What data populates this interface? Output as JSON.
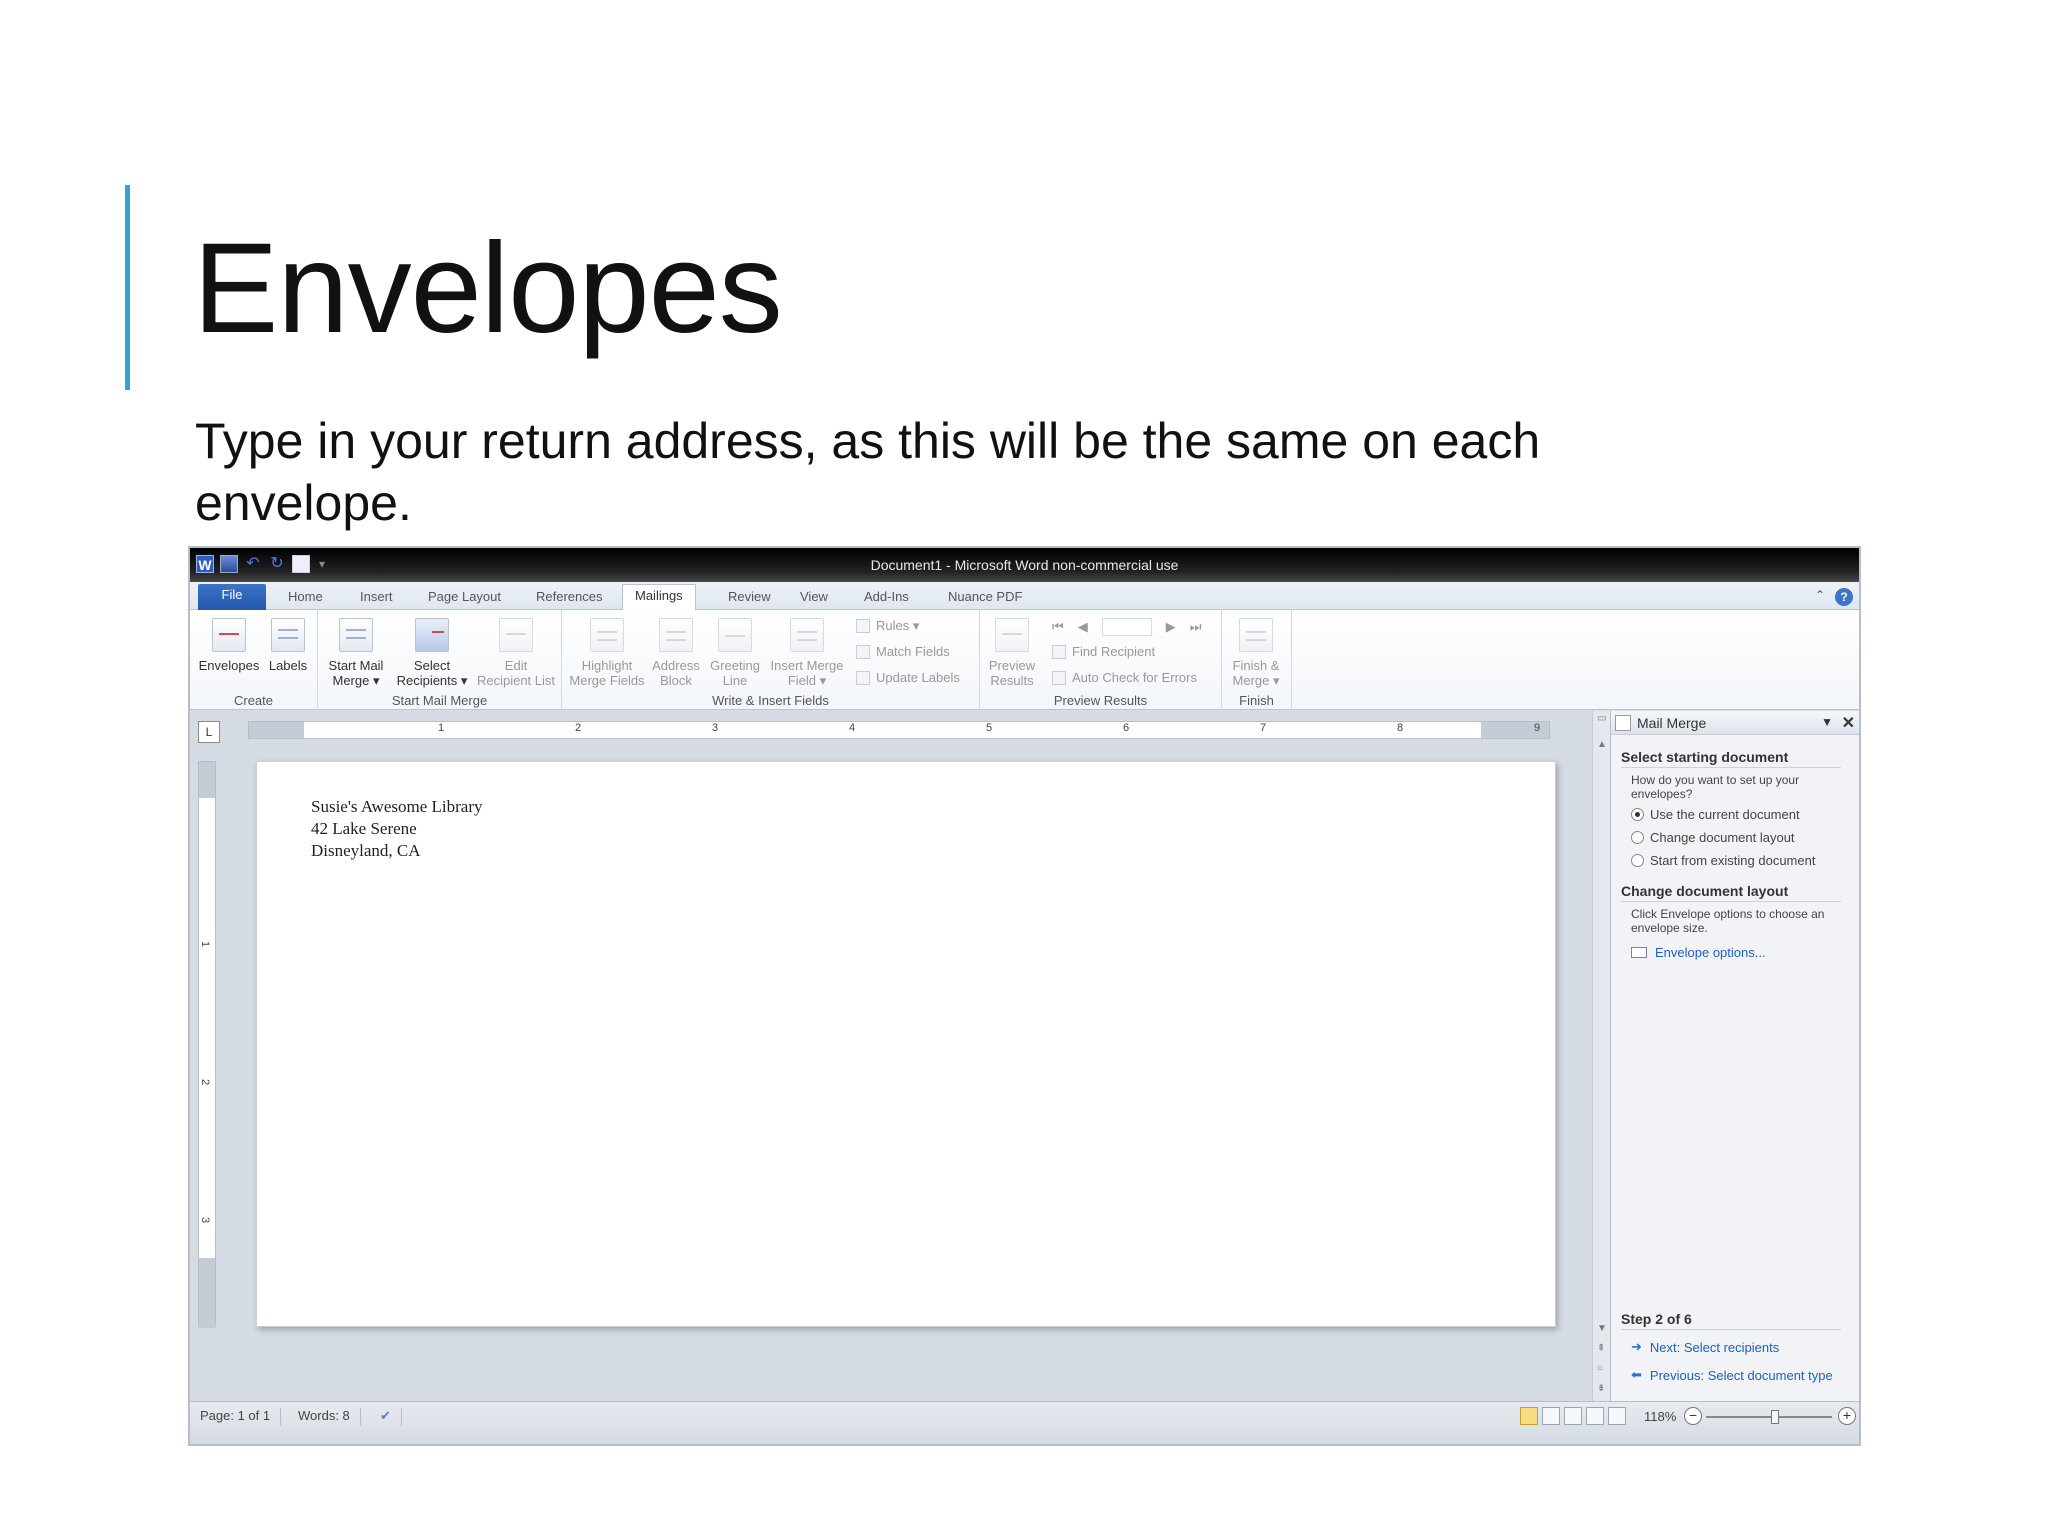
{
  "slide": {
    "title": "Envelopes",
    "body": "Type in your return address, as this will be the same on each envelope.",
    "accent_color": "#31a5d0"
  },
  "window": {
    "title": "Document1  -  Microsoft Word non-commercial use"
  },
  "tabs": [
    {
      "label": "File"
    },
    {
      "label": "Home"
    },
    {
      "label": "Insert"
    },
    {
      "label": "Page Layout"
    },
    {
      "label": "References"
    },
    {
      "label": "Mailings",
      "active": true
    },
    {
      "label": "Review"
    },
    {
      "label": "View"
    },
    {
      "label": "Add-Ins"
    },
    {
      "label": "Nuance PDF"
    }
  ],
  "ribbon": {
    "create": {
      "label": "Create",
      "envelopes": "Envelopes",
      "labels": "Labels"
    },
    "start_mail_merge": {
      "label": "Start Mail Merge",
      "start_mail_merge": [
        "Start Mail",
        "Merge ▾"
      ],
      "select_recipients": [
        "Select",
        "Recipients ▾"
      ],
      "edit_recipient_list": [
        "Edit",
        "Recipient List"
      ]
    },
    "write_insert": {
      "label": "Write & Insert Fields",
      "highlight": [
        "Highlight",
        "Merge Fields"
      ],
      "address_block": [
        "Address",
        "Block"
      ],
      "greeting_line": [
        "Greeting",
        "Line"
      ],
      "insert_merge_field": [
        "Insert Merge",
        "Field ▾"
      ],
      "rules": "Rules ▾",
      "match_fields": "Match Fields",
      "update_labels": "Update Labels"
    },
    "preview": {
      "label": "Preview Results",
      "preview_results": [
        "Preview",
        "Results"
      ],
      "find_recipient": "Find Recipient",
      "auto_check": "Auto Check for Errors"
    },
    "finish": {
      "label": "Finish",
      "finish_merge": [
        "Finish &",
        "Merge ▾"
      ]
    }
  },
  "ruler": {
    "corner": "L",
    "h_ticks": [
      "1",
      "2",
      "3",
      "4",
      "5",
      "6",
      "7",
      "8",
      "9"
    ],
    "v_ticks": [
      "1",
      "2",
      "3"
    ]
  },
  "document": {
    "return_address": [
      "Susie's Awesome Library",
      "42 Lake Serene",
      "Disneyland, CA"
    ]
  },
  "task_pane": {
    "title": "Mail Merge",
    "section1_title": "Select starting document",
    "section1_question": "How do you want to set up your envelopes?",
    "options": [
      {
        "label": "Use the current document",
        "selected": true
      },
      {
        "label": "Change document layout",
        "selected": false
      },
      {
        "label": "Start from existing document",
        "selected": false
      }
    ],
    "section2_title": "Change document layout",
    "section2_text": "Click Envelope options to choose an envelope size.",
    "envelope_options_link": "Envelope options...",
    "step": "Step 2 of 6",
    "next_link": "Next: Select recipients",
    "previous_link": "Previous: Select document type"
  },
  "status": {
    "page": "Page: 1 of 1",
    "words": "Words: 8",
    "zoom": "118%",
    "zoom_fraction": 0.55
  }
}
